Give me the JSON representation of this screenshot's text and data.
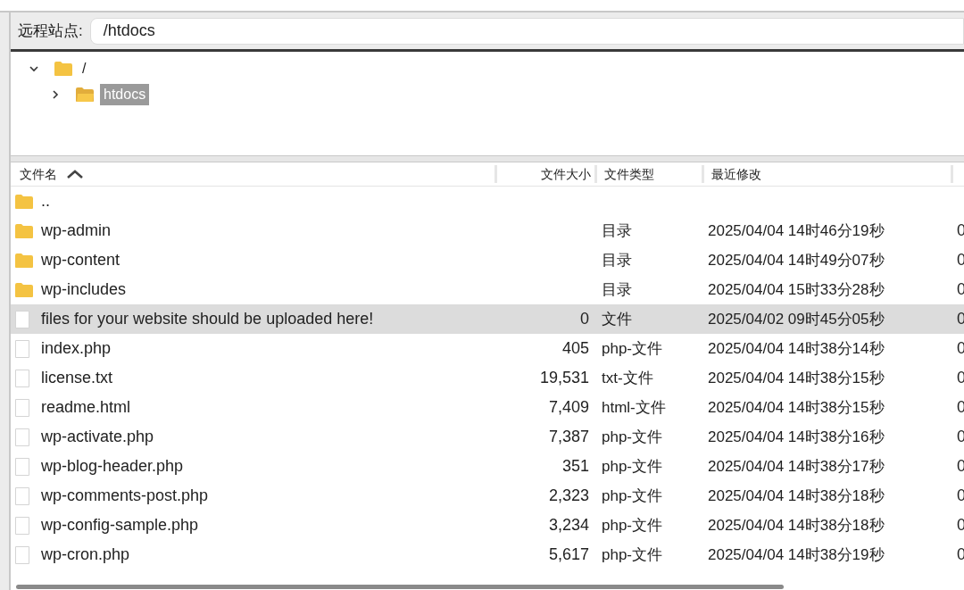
{
  "address_bar": {
    "label": "远程站点:",
    "value": "/htdocs"
  },
  "tree": [
    {
      "name": "/",
      "expanded": true,
      "selected": false,
      "children": [
        {
          "name": "htdocs",
          "expanded": false,
          "selected": true
        }
      ]
    }
  ],
  "table": {
    "columns": [
      "文件名",
      "文件大小",
      "文件类型",
      "最近修改"
    ],
    "rows": [
      {
        "kind": "folder",
        "name": "..",
        "selected": false
      },
      {
        "kind": "folder",
        "name": "wp-admin",
        "size": "",
        "type": "目录",
        "modified": "2025/04/04 14时46分19秒",
        "column_5": "0",
        "selected": false
      },
      {
        "kind": "folder",
        "name": "wp-content",
        "size": "",
        "type": "目录",
        "modified": "2025/04/04 14时49分07秒",
        "column_5": "0",
        "selected": false
      },
      {
        "kind": "folder",
        "name": "wp-includes",
        "size": "",
        "type": "目录",
        "modified": "2025/04/04 15时33分28秒",
        "column_5": "0",
        "selected": false
      },
      {
        "kind": "file",
        "name": "files for your website should be uploaded here!",
        "size": "0",
        "type": "文件",
        "modified": "2025/04/02 09时45分05秒",
        "column_5": "0",
        "selected": true
      },
      {
        "kind": "file",
        "name": "index.php",
        "size": "405",
        "type": "php-文件",
        "modified": "2025/04/04 14时38分14秒",
        "column_5": "0",
        "selected": false
      },
      {
        "kind": "file",
        "name": "license.txt",
        "size": "19,531",
        "type": "txt-文件",
        "modified": "2025/04/04 14时38分15秒",
        "column_5": "0",
        "selected": false
      },
      {
        "kind": "file",
        "name": "readme.html",
        "size": "7,409",
        "type": "html-文件",
        "modified": "2025/04/04 14时38分15秒",
        "column_5": "0",
        "selected": false
      },
      {
        "kind": "file",
        "name": "wp-activate.php",
        "size": "7,387",
        "type": "php-文件",
        "modified": "2025/04/04 14时38分16秒",
        "column_5": "0",
        "selected": false
      },
      {
        "kind": "file",
        "name": "wp-blog-header.php",
        "size": "351",
        "type": "php-文件",
        "modified": "2025/04/04 14时38分17秒",
        "column_5": "0",
        "selected": false
      },
      {
        "kind": "file",
        "name": "wp-comments-post.php",
        "size": "2,323",
        "type": "php-文件",
        "modified": "2025/04/04 14时38分18秒",
        "column_5": "0",
        "selected": false
      },
      {
        "kind": "file",
        "name": "wp-config-sample.php",
        "size": "3,234",
        "type": "php-文件",
        "modified": "2025/04/04 14时38分18秒",
        "column_5": "0",
        "selected": false
      },
      {
        "kind": "file",
        "name": "wp-cron.php",
        "size": "5,617",
        "type": "php-文件",
        "modified": "2025/04/04 14时38分19秒",
        "column_5": "0",
        "selected": false
      }
    ]
  }
}
